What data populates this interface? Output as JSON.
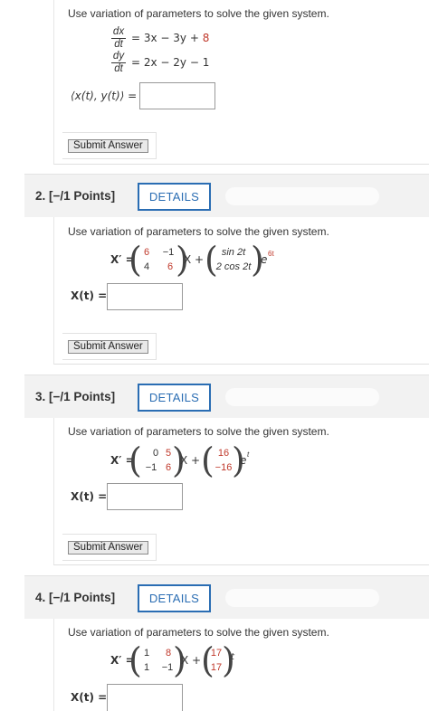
{
  "q1": {
    "prompt": "Use variation of parameters to solve the given system.",
    "eq1_num": "dx",
    "eq1_den": "dt",
    "eq1_rhs_a": "= 3x − 3y + ",
    "eq1_rhs_b": "8",
    "eq2_num": "dy",
    "eq2_den": "dt",
    "eq2_rhs": "= 2x − 2y − 1",
    "answer_label": "⟨x(t), y(t)⟩ =",
    "submit": "Submit Answer"
  },
  "q2": {
    "number": "2.",
    "points": "[−/1 Points]",
    "details": "DETAILS",
    "prompt": "Use variation of parameters to solve the given system.",
    "lhs": "X′ =",
    "m": [
      "6",
      "−1",
      "4",
      "6"
    ],
    "xplus": "X +",
    "f": [
      "sin 2t",
      "2 cos 2t"
    ],
    "exp_base": "e",
    "exp_power": "6t",
    "answer_label": "X(t) =",
    "submit": "Submit Answer"
  },
  "q3": {
    "number": "3.",
    "points": "[−/1 Points]",
    "details": "DETAILS",
    "prompt": "Use variation of parameters to solve the given system.",
    "lhs": "X′ =",
    "m": [
      "0",
      "5",
      "−1",
      "6"
    ],
    "xplus": "X +",
    "f": [
      "16",
      "−16"
    ],
    "exp_base": "e",
    "exp_power": "t",
    "answer_label": "X(t) =",
    "submit": "Submit Answer"
  },
  "q4": {
    "number": "4.",
    "points": "[−/1 Points]",
    "details": "DETAILS",
    "prompt": "Use variation of parameters to solve the given system.",
    "lhs": "X′ =",
    "m": [
      "1",
      "8",
      "1",
      "−1"
    ],
    "xplus": "X +",
    "f": [
      "17",
      "17"
    ],
    "t_suffix": "t",
    "answer_label": "X(t) ="
  }
}
